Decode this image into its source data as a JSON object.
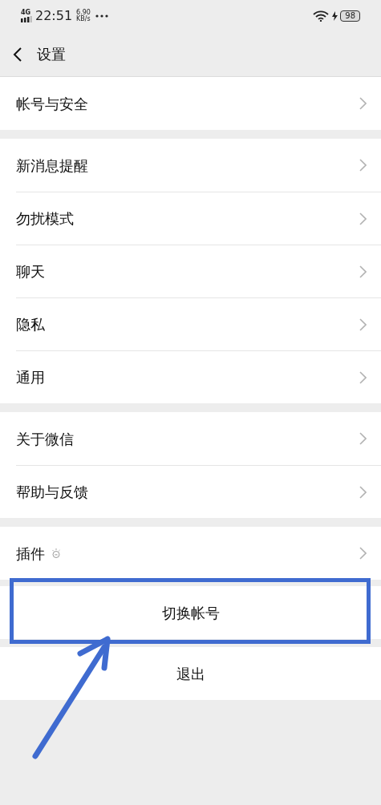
{
  "status_bar": {
    "network": "4G",
    "time": "22:51",
    "speed": "6.90",
    "speed_unit": "KB/s",
    "battery": "98"
  },
  "header": {
    "title": "设置"
  },
  "groups": [
    {
      "items": [
        {
          "label": "帐号与安全",
          "kind": "plain"
        }
      ]
    },
    {
      "items": [
        {
          "label": "新消息提醒",
          "kind": "plain"
        },
        {
          "label": "勿扰模式",
          "kind": "plain"
        },
        {
          "label": "聊天",
          "kind": "plain"
        },
        {
          "label": "隐私",
          "kind": "plain"
        },
        {
          "label": "通用",
          "kind": "plain"
        }
      ]
    },
    {
      "items": [
        {
          "label": "关于微信",
          "kind": "plain"
        },
        {
          "label": "帮助与反馈",
          "kind": "plain"
        }
      ]
    },
    {
      "items": [
        {
          "label": "插件",
          "kind": "plugin"
        }
      ]
    }
  ],
  "buttons": [
    {
      "label": "切换帐号",
      "highlighted": true
    },
    {
      "label": "退出",
      "highlighted": false
    }
  ]
}
